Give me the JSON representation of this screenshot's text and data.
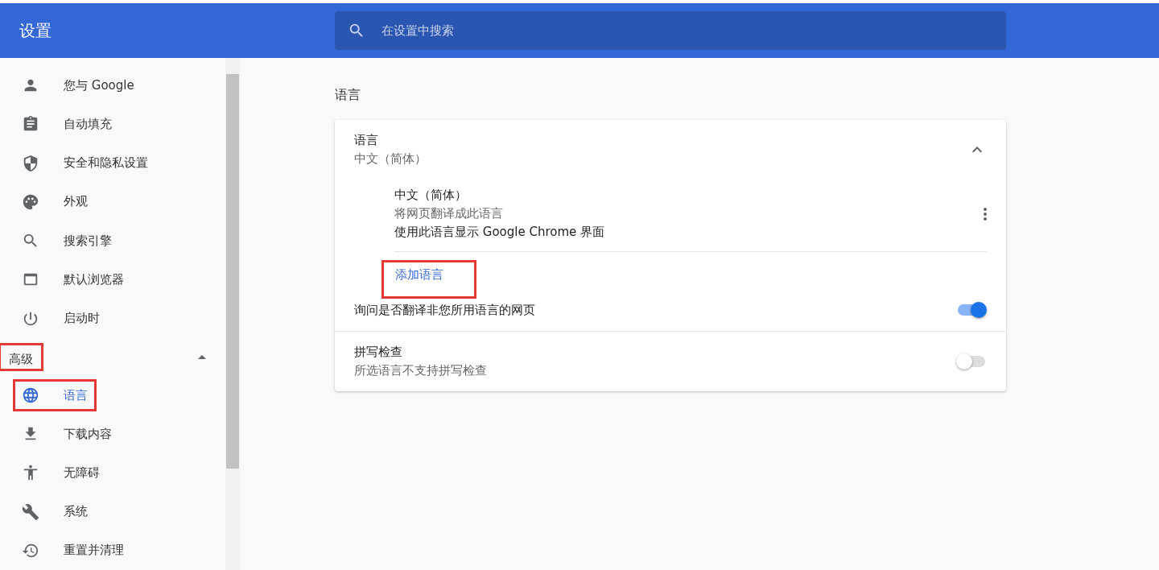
{
  "header": {
    "title": "设置",
    "search": {
      "placeholder": "在设置中搜索"
    }
  },
  "sidebar": {
    "items": [
      {
        "label": "您与 Google",
        "selected": false,
        "highlighted": false
      },
      {
        "label": "自动填充",
        "selected": false,
        "highlighted": false
      },
      {
        "label": "安全和隐私设置",
        "selected": false,
        "highlighted": false
      },
      {
        "label": "外观",
        "selected": false,
        "highlighted": false
      },
      {
        "label": "搜索引擎",
        "selected": false,
        "highlighted": false
      },
      {
        "label": "默认浏览器",
        "selected": false,
        "highlighted": false
      },
      {
        "label": "启动时",
        "selected": false,
        "highlighted": false
      }
    ],
    "advanced": {
      "label": "高级",
      "expanded": true,
      "highlighted": true,
      "children": [
        {
          "label": "语言",
          "selected": true,
          "highlighted": true
        },
        {
          "label": "下载内容",
          "selected": false,
          "highlighted": false
        },
        {
          "label": "无障碍",
          "selected": false,
          "highlighted": false
        },
        {
          "label": "系统",
          "selected": false,
          "highlighted": false
        },
        {
          "label": "重置并清理",
          "selected": false,
          "highlighted": false
        }
      ]
    }
  },
  "section_title": "语言",
  "card": {
    "title": "语言",
    "subtitle": "中文（简体）",
    "expanded": true,
    "languages": [
      {
        "name": "中文（简体）",
        "line_1": "将网页翻译成此语言",
        "line_2": "使用此语言显示 Google Chrome 界面"
      }
    ],
    "add_language": {
      "label": "添加语言",
      "highlighted": true
    },
    "toggles": [
      {
        "label": "询问是否翻译非您所用语言的网页",
        "on": true
      },
      {
        "label": "拼写检查",
        "sublabel": "所选语言不支持拼写检查",
        "on": false
      }
    ]
  }
}
